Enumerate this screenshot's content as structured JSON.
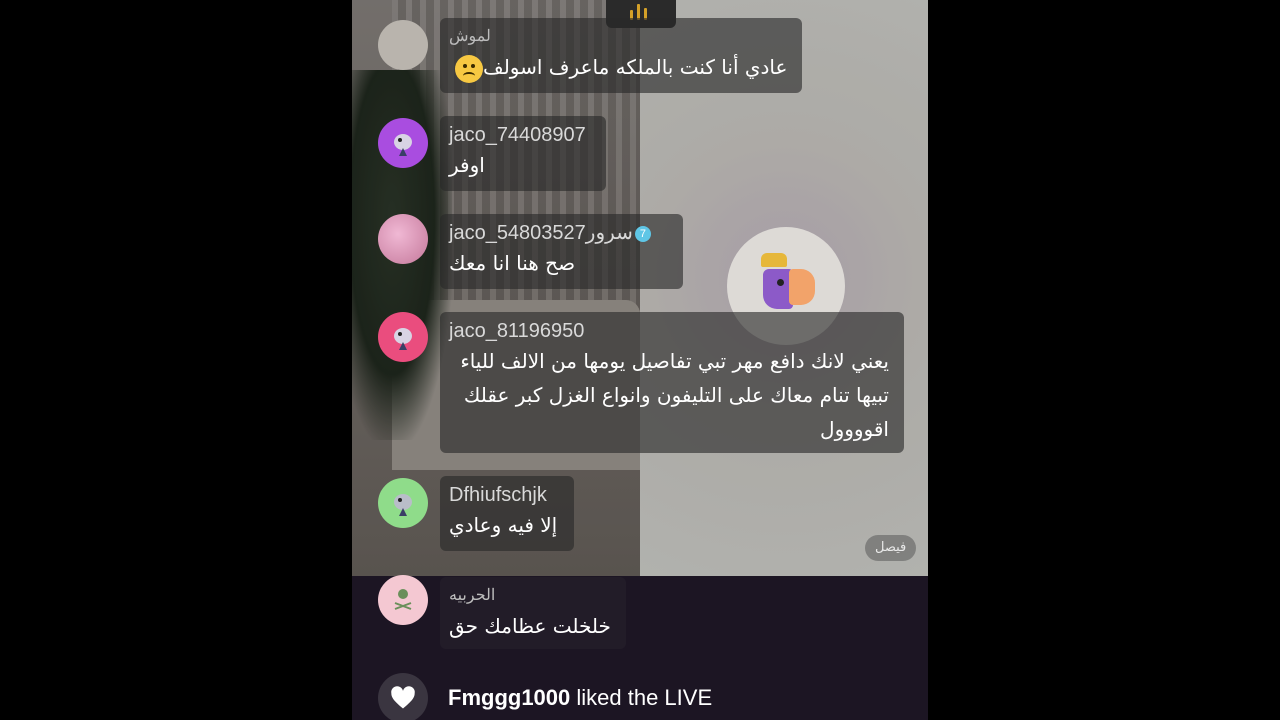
{
  "comments": [
    {
      "username": "لموش",
      "message": "عادي أنا كنت بالملكه ماعرف اسولف",
      "avatar_color": "#b9b4ad"
    },
    {
      "username": "jaco_74408907",
      "message": "اوفر",
      "avatar_color": "#a94de0"
    },
    {
      "username": "jaco_54803527سرور",
      "badge": "7",
      "message": "صح هنا انا معك",
      "avatar_color": "#d9a6c2"
    },
    {
      "username": "jaco_81196950",
      "message": "يعني لانك دافع مهر تبي تفاصيل يومها من الالف للياء تبيها تنام معاك على التليفون وانواع الغزل كبر عقلك اقوووول",
      "avatar_color": "#ea4d7e"
    },
    {
      "username": "Dfhiufschjk",
      "message": "إلا فيه وعادي",
      "avatar_color": "#8fdc8a"
    },
    {
      "username": "الحربيه",
      "message": "خلخلت عظامك حق",
      "avatar_color": "#f4c8d2"
    }
  ],
  "like_event": {
    "user": "Fmggg1000",
    "text": " liked the LIVE"
  },
  "guest_name": "فيصل",
  "colors": {
    "accent_badge": "#5fc6e6",
    "emoji": "#f7c842",
    "top_indicator": "#d4a028"
  }
}
